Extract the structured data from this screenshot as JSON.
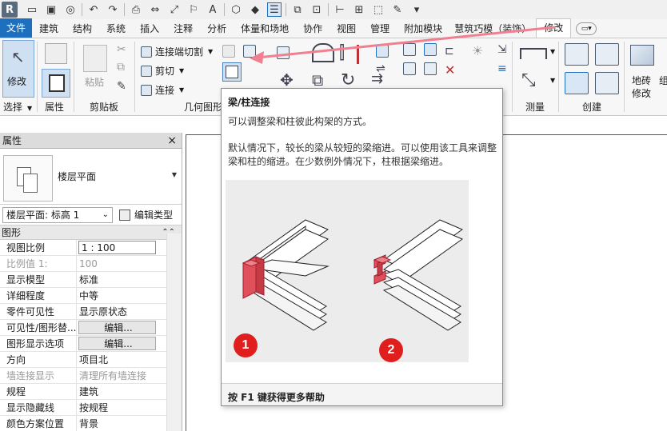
{
  "qat": {
    "logo": "R",
    "text_glyph": "A"
  },
  "tabs": [
    {
      "label": "文件"
    },
    {
      "label": "建筑"
    },
    {
      "label": "结构"
    },
    {
      "label": "系统"
    },
    {
      "label": "插入"
    },
    {
      "label": "注释"
    },
    {
      "label": "分析"
    },
    {
      "label": "体量和场地"
    },
    {
      "label": "协作"
    },
    {
      "label": "视图"
    },
    {
      "label": "管理"
    },
    {
      "label": "附加模块"
    },
    {
      "label": "慧筑巧模（装饰）"
    },
    {
      "label": "修改"
    }
  ],
  "ribbon": {
    "modify_label": "修改",
    "select_panel": "选择",
    "properties_panel": "属性",
    "clipboard": {
      "paste": "粘贴",
      "panel": "剪贴板"
    },
    "geometry": {
      "join_cut": "连接端切割",
      "cut": "剪切",
      "join": "连接",
      "panel": "几何图形"
    },
    "measure_panel": "测量",
    "create_panel": "创建",
    "floor_finish": "地砖",
    "floor_finish_sub": "修改",
    "trailing_label": "组"
  },
  "properties": {
    "title": "属性",
    "close": "×",
    "type_name": "楼层平面",
    "instance_selector": "楼层平面: 标高 1",
    "edit_type": "编辑类型",
    "category": "图形",
    "rows": [
      {
        "key": "视图比例",
        "value": "1 : 100"
      },
      {
        "key": "比例值 1:",
        "value": "100"
      },
      {
        "key": "显示模型",
        "value": "标准"
      },
      {
        "key": "详细程度",
        "value": "中等"
      },
      {
        "key": "零件可见性",
        "value": "显示原状态"
      },
      {
        "key": "可见性/图形替...",
        "value": "编辑..."
      },
      {
        "key": "图形显示选项",
        "value": "编辑..."
      },
      {
        "key": "方向",
        "value": "项目北"
      },
      {
        "key": "墙连接显示",
        "value": "清理所有墙连接"
      },
      {
        "key": "规程",
        "value": "建筑"
      },
      {
        "key": "显示隐藏线",
        "value": "按规程"
      },
      {
        "key": "颜色方案位置",
        "value": "背景"
      }
    ]
  },
  "tooltip": {
    "title": "梁/柱连接",
    "description": "可以调整梁和柱彼此构架的方式。",
    "detail": "默认情况下，较长的梁从较短的梁缩进。可以使用该工具来调整梁和柱的缩进。在少数例外情况下，柱根据梁缩进。",
    "badge_1": "1",
    "badge_2": "2",
    "footer": "按 F1 键获得更多帮助"
  },
  "colors": {
    "accent_blue": "#1e6fbd",
    "highlight_red": "#e01e1e",
    "arrow_pink": "#f08090",
    "beam_red": "#e0505a"
  }
}
